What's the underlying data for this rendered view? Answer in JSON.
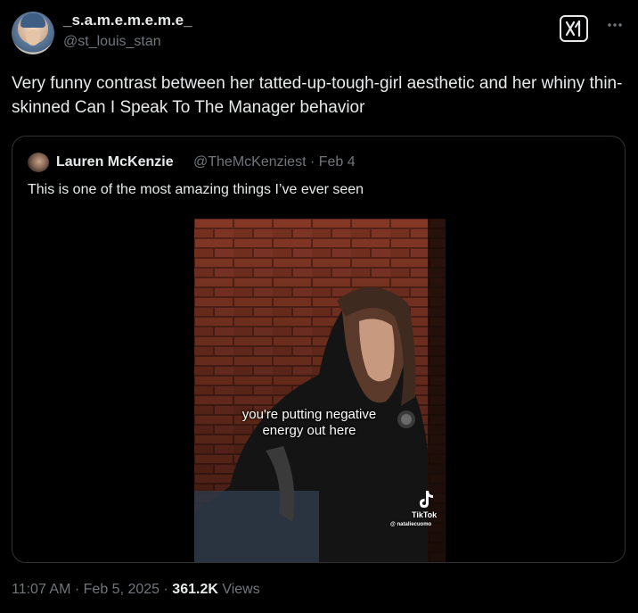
{
  "tweet": {
    "author": {
      "display_name": "_s.a.m.e.m.e.m.e_",
      "handle": "@st_louis_stan"
    },
    "text": "Very funny contrast between her tatted-up-tough-girl aesthetic and her whiny thin-skinned Can I Speak To The Manager behavior",
    "time": "11:07 AM",
    "date": "Feb 5, 2025",
    "separator": "·",
    "views_count": "361.2K",
    "views_label": "Views"
  },
  "quoted_tweet": {
    "author": {
      "display_name": "Lauren McKenzie",
      "handle": "@TheMcKenziest",
      "date": "Feb 4"
    },
    "separator": "·",
    "text": "This is one of the most amazing things I’ve ever seen",
    "video": {
      "caption_line1": "you're putting negative",
      "caption_line2": "energy out here",
      "watermark": "TikTok",
      "watermark_user": "@ nataliecuomo"
    }
  },
  "icons": {
    "grok": "grok-icon",
    "more": "more-horizontal-icon",
    "tiktok": "tiktok-icon"
  },
  "colors": {
    "background": "#000000",
    "text_primary": "#e7e9ea",
    "text_secondary": "#71767b",
    "border": "#2f3336"
  }
}
